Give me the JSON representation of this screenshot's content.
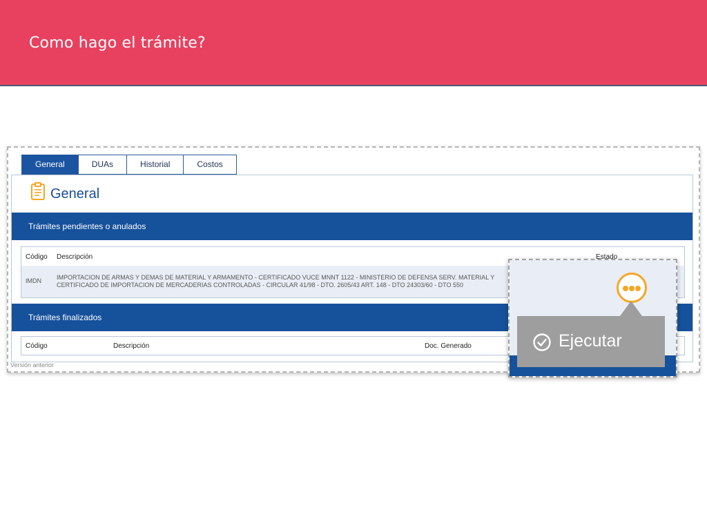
{
  "banner": {
    "title": "Como hago el trámite?"
  },
  "tabs": [
    {
      "label": "General",
      "active": true
    },
    {
      "label": "DUAs",
      "active": false
    },
    {
      "label": "Historial",
      "active": false
    },
    {
      "label": "Costos",
      "active": false
    }
  ],
  "panel": {
    "title": "General",
    "icon": "clipboard-icon",
    "pending": {
      "heading": "Trámites pendientes o anulados",
      "columns": {
        "code": "Código",
        "description": "Descripción",
        "status": "Estado"
      },
      "rows": [
        {
          "code": "IMDN",
          "description_line1": "IMPORTACION DE ARMAS Y DEMAS DE MATERIAL Y ARMAMENTO - CERTIFICADO VUCE MNNT 1122 - MINISTERIO DE DEFENSA SERV. MATERIAL Y",
          "description_line2": "CERTIFICADO DE IMPORTACION DE MERCADERIAS CONTROLADAS - CIRCULAR 41/98 - DTO. 2605/43 ART. 148 - DTO 24303/60 - DTO 550"
        }
      ]
    },
    "finished": {
      "heading": "Trámites finalizados",
      "columns": {
        "code": "Código",
        "description": "Descripción",
        "doc": "Doc. Generado"
      }
    },
    "version_link": "Versión anterior"
  },
  "callout": {
    "menu_icon": "more-options-icon",
    "action_label": "Ejecutar",
    "action_icon": "check-circle-icon"
  },
  "colors": {
    "banner": "#e8415f",
    "primary": "#16519b",
    "accent": "#f5a623",
    "tooltip": "#9e9e9e"
  }
}
